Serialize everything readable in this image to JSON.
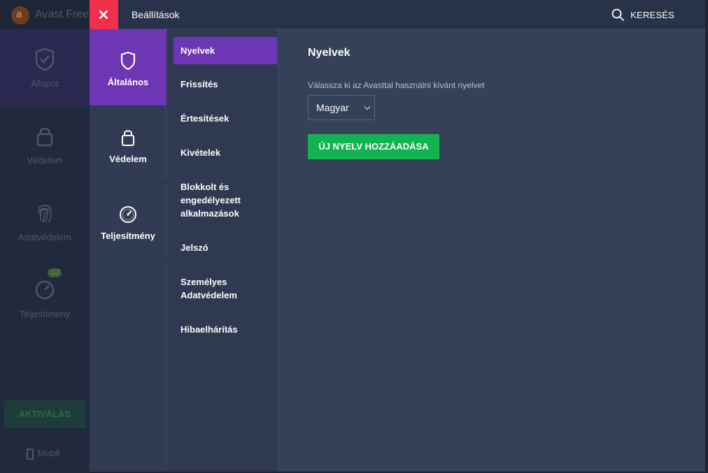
{
  "background_app": {
    "title": "Avast Free A",
    "logo_glyph": "a",
    "nav": [
      {
        "label": "Állapot",
        "icon": "shield-check-icon"
      },
      {
        "label": "Védelem",
        "icon": "lock-icon"
      },
      {
        "label": "Adatvédelem",
        "icon": "fingerprint-icon"
      },
      {
        "label": "Teljesítmény",
        "icon": "speedometer-icon",
        "badge": "ÚJ"
      }
    ],
    "activate_label": "AKTIVÁLÁS",
    "mobile_label": "Mobil"
  },
  "settings": {
    "close_icon": "close-icon",
    "title": "Beállítások",
    "search_label": "KERESÉS",
    "categories": [
      {
        "label": "Általános",
        "icon": "shield-icon",
        "active": true
      },
      {
        "label": "Védelem",
        "icon": "lock-icon",
        "active": false
      },
      {
        "label": "Teljesítmény",
        "icon": "speedometer-icon",
        "active": false
      }
    ],
    "subcategories": [
      {
        "label": "Nyelvek",
        "active": true
      },
      {
        "label": "Frissítés"
      },
      {
        "label": "Értesítések"
      },
      {
        "label": "Kivételek"
      },
      {
        "label": "Blokkolt és engedélyezett alkalmazások"
      },
      {
        "label": "Jelszó"
      },
      {
        "label": "Személyes Adatvédelem"
      },
      {
        "label": "Hibaelhárítás"
      }
    ],
    "content": {
      "title": "Nyelvek",
      "language_label": "Válassza ki az Avasttal használni kívánt nyelvet",
      "language_value": "Magyar",
      "add_language_button": "ÚJ NYELV HOZZÁADÁSA"
    }
  },
  "colors": {
    "accent_purple": "#6e36b4",
    "close_red": "#f0304a",
    "button_green": "#12b451",
    "panel_bg": "#354059"
  }
}
